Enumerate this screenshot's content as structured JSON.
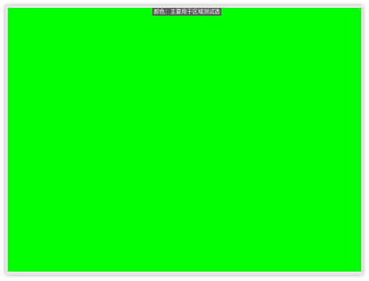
{
  "window": {
    "title": "颜色：主要用于区域测试选",
    "fill_color": "#00ff00"
  }
}
